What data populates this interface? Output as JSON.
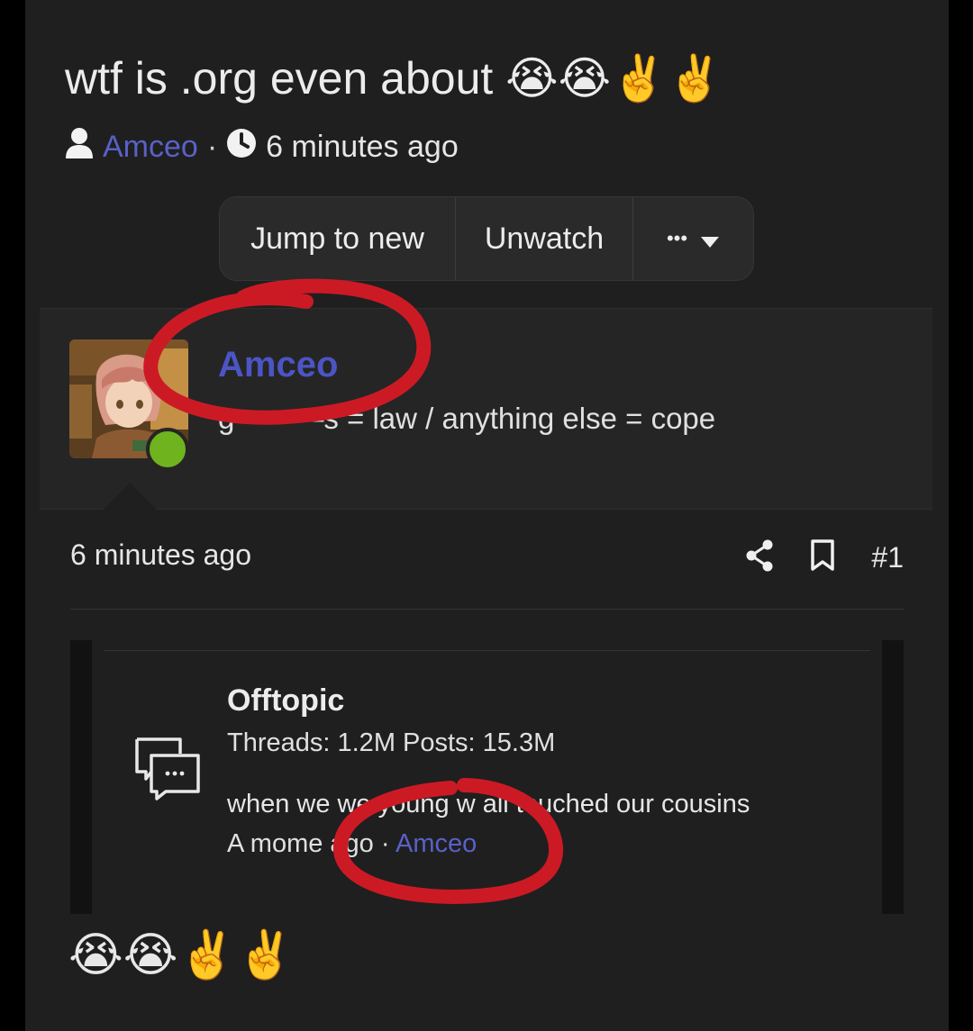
{
  "thread": {
    "title": "wtf is .org even about 😭😭✌️✌️",
    "author": "Amceo",
    "separator": "·",
    "time": "6 minutes ago"
  },
  "buttons": {
    "jump": "Jump to new",
    "unwatch": "Unwatch",
    "more": "•••"
  },
  "post": {
    "username": "Amceo",
    "user_title": "g———s = law / anything else = cope",
    "date": "6 minutes ago",
    "number": "#1",
    "online": true,
    "body_emoji": "😭😭✌️✌️"
  },
  "embed": {
    "forum_title": "Offtopic",
    "stats": "Threads: 1.2M Posts: 15.3M",
    "latest_title": "when we we young w all touched our cousins",
    "latest_time": "A mome ago",
    "latest_sep": " · ",
    "latest_author": "Amceo"
  },
  "colors": {
    "accent": "#4b55c4",
    "online": "#6fb31e",
    "annotation": "#cc1a25"
  },
  "icons": {
    "user": "user-icon",
    "clock": "clock-icon",
    "caret": "caret-down-icon",
    "share": "share-icon",
    "bookmark": "bookmark-icon",
    "forum": "chat-bubbles-icon"
  }
}
